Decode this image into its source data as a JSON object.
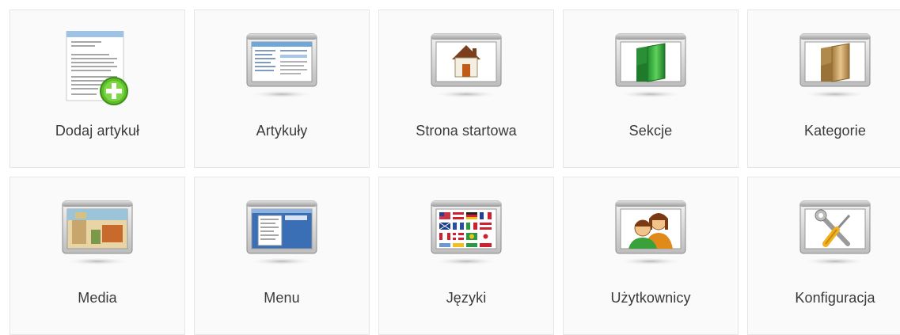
{
  "tiles": [
    {
      "label": "Dodaj artykuł",
      "icon": "add-article-icon"
    },
    {
      "label": "Artykuły",
      "icon": "articles-icon"
    },
    {
      "label": "Strona startowa",
      "icon": "home-icon"
    },
    {
      "label": "Sekcje",
      "icon": "sections-folder-icon"
    },
    {
      "label": "Kategorie",
      "icon": "categories-folder-icon"
    },
    {
      "label": "Media",
      "icon": "media-icon"
    },
    {
      "label": "Menu",
      "icon": "menu-icon"
    },
    {
      "label": "Języki",
      "icon": "languages-flags-icon"
    },
    {
      "label": "Użytkownicy",
      "icon": "users-icon"
    },
    {
      "label": "Konfiguracja",
      "icon": "configuration-tools-icon"
    }
  ]
}
